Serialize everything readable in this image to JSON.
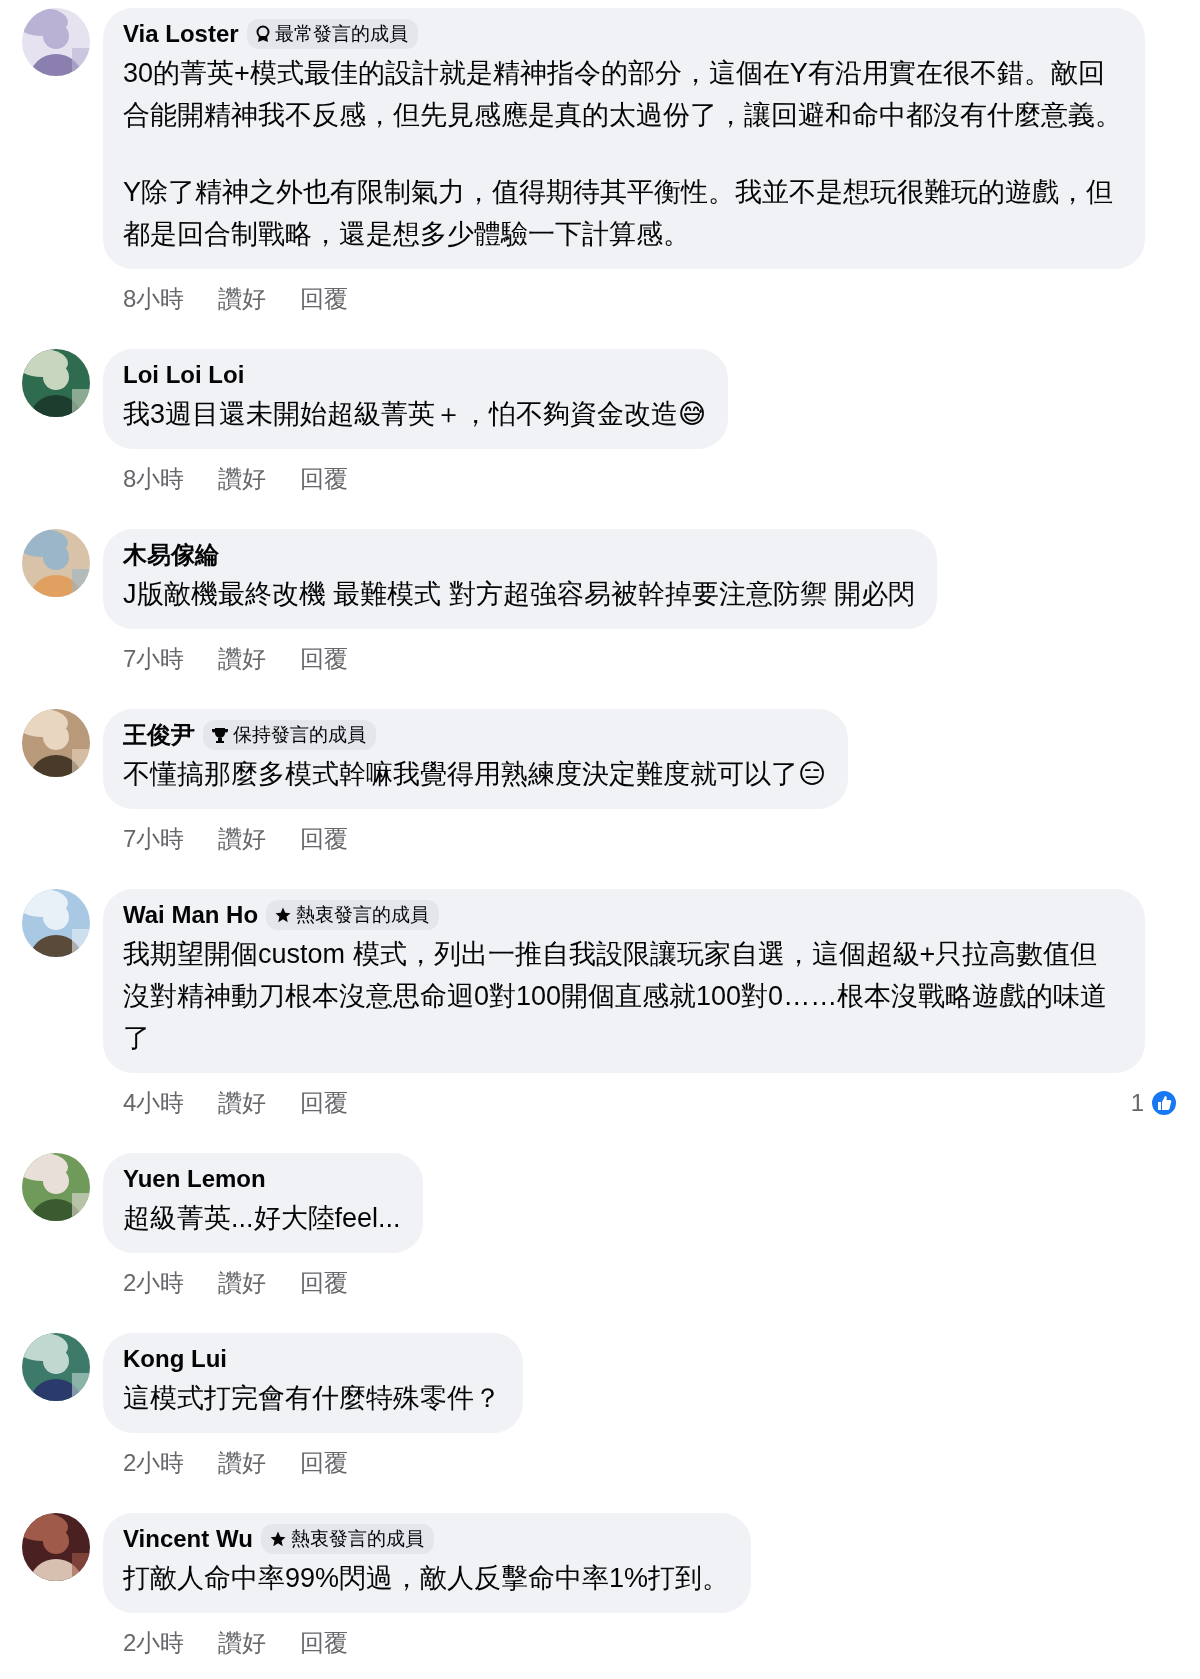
{
  "comments": [
    {
      "author": "Via Loster",
      "badge": {
        "kind": "ribbon",
        "label": "最常發言的成員"
      },
      "paragraphs": [
        "30的菁英+模式最佳的設計就是精神指令的部分，這個在Y有沿用實在很不錯。敵回合能開精神我不反感，但先見感應是真的太過份了，讓回避和命中都沒有什麼意義。",
        "Y除了精神之外也有限制氣力，值得期待其平衡性。我並不是想玩很難玩的遊戲，但都是回合制戰略，還是想多少體驗一下計算感。"
      ],
      "time": "8小時",
      "like": "讚好",
      "reply": "回覆"
    },
    {
      "author": "Loi Loi Loi",
      "paragraphs": [
        "我3週目還未開始超級菁英＋，怕不夠資金改造😅"
      ],
      "time": "8小時",
      "like": "讚好",
      "reply": "回覆"
    },
    {
      "author": "木易傢綸",
      "paragraphs": [
        "J版敵機最終改機 最難模式 對方超強容易被幹掉要注意防禦 開必閃"
      ],
      "time": "7小時",
      "like": "讚好",
      "reply": "回覆"
    },
    {
      "author": "王俊尹",
      "badge": {
        "kind": "trophy",
        "label": "保持發言的成員"
      },
      "paragraphs": [
        "不懂搞那麼多模式幹嘛我覺得用熟練度決定難度就可以了😑"
      ],
      "time": "7小時",
      "like": "讚好",
      "reply": "回覆"
    },
    {
      "author": "Wai Man Ho",
      "badge": {
        "kind": "star",
        "label": "熱衷發言的成員"
      },
      "paragraphs": [
        "我期望開個custom 模式，列出一推自我設限讓玩家自選，這個超級+只拉高數值但沒對精神動刀根本沒意思命迴0對100開個直感就100對0……根本沒戰略遊戲的味道了"
      ],
      "time": "4小時",
      "like": "讚好",
      "reply": "回覆",
      "reactions": "1"
    },
    {
      "author": "Yuen Lemon",
      "paragraphs": [
        "超級菁英...好大陸feel..."
      ],
      "time": "2小時",
      "like": "讚好",
      "reply": "回覆"
    },
    {
      "author": "Kong Lui",
      "paragraphs": [
        "這模式打完會有什麼特殊零件？"
      ],
      "time": "2小時",
      "like": "讚好",
      "reply": "回覆"
    },
    {
      "author": "Vincent Wu",
      "badge": {
        "kind": "star",
        "label": "熱衷發言的成員"
      },
      "paragraphs": [
        "打敵人命中率99%閃過，敵人反擊命中率1%打到。"
      ],
      "time": "2小時",
      "like": "讚好",
      "reply": "回覆"
    }
  ]
}
